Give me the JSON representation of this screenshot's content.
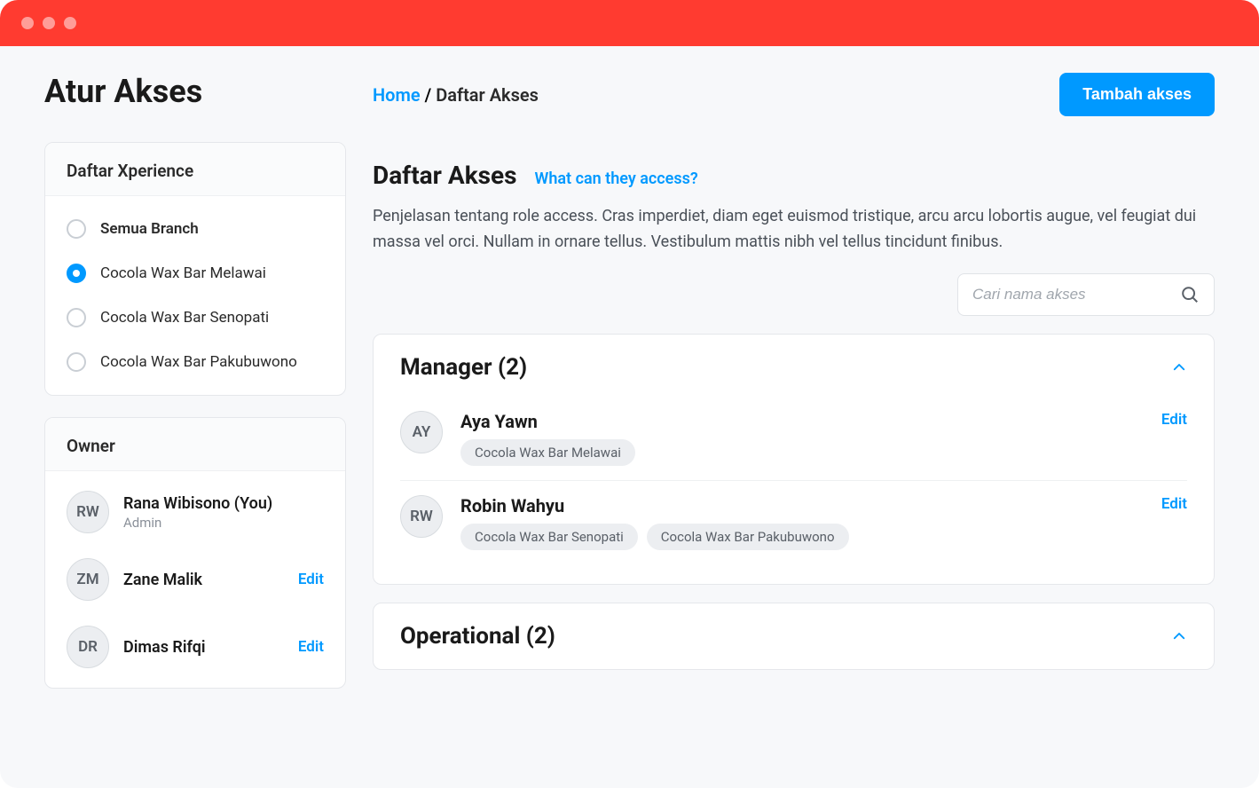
{
  "page_title": "Atur Akses",
  "breadcrumb": {
    "home": "Home",
    "sep": " / ",
    "current": "Daftar Akses"
  },
  "add_button": "Tambah akses",
  "sidebar": {
    "xperience_header": "Daftar Xperience",
    "branches": [
      {
        "label": "Semua Branch",
        "selected": false,
        "bold": true
      },
      {
        "label": "Cocola Wax Bar Melawai",
        "selected": true,
        "bold": false
      },
      {
        "label": "Cocola Wax Bar Senopati",
        "selected": false,
        "bold": false
      },
      {
        "label": "Cocola Wax Bar Pakubuwono",
        "selected": false,
        "bold": false
      }
    ],
    "owner_header": "Owner",
    "owners": [
      {
        "initials": "RW",
        "name": "Rana Wibisono (You)",
        "role": "Admin",
        "editable": false
      },
      {
        "initials": "ZM",
        "name": "Zane Malik",
        "role": "",
        "editable": true
      },
      {
        "initials": "DR",
        "name": "Dimas Rifqi",
        "role": "",
        "editable": true
      }
    ],
    "edit_label": "Edit"
  },
  "main": {
    "title": "Daftar Akses",
    "help_link": "What can they access?",
    "description": "Penjelasan tentang role access. Cras imperdiet, diam eget euismod tristique, arcu arcu lobortis augue, vel feugiat dui massa vel orci. Nullam in ornare tellus. Vestibulum mattis nibh vel tellus tincidunt finibus.",
    "search_placeholder": "Cari nama akses",
    "roles": [
      {
        "title": "Manager (2)",
        "expanded": true,
        "members": [
          {
            "initials": "AY",
            "name": "Aya Yawn",
            "branches": [
              "Cocola Wax Bar Melawai"
            ]
          },
          {
            "initials": "RW",
            "name": "Robin Wahyu",
            "branches": [
              "Cocola Wax Bar Senopati",
              "Cocola Wax Bar Pakubuwono"
            ]
          }
        ]
      },
      {
        "title": "Operational (2)",
        "expanded": true,
        "members": []
      }
    ],
    "edit_label": "Edit"
  }
}
